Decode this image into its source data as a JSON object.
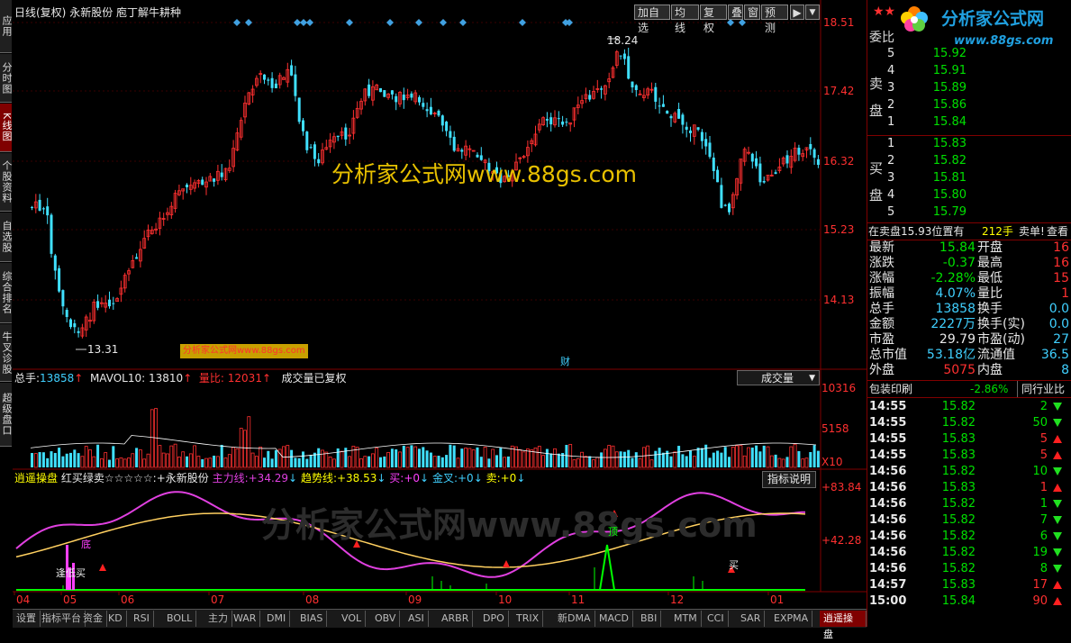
{
  "left_tabs": [
    {
      "label": "应用",
      "active": false
    },
    {
      "label": "分时图",
      "active": false
    },
    {
      "label": "K线图",
      "active": true
    },
    {
      "label": "个股资料",
      "active": false
    },
    {
      "label": "自选股",
      "active": false
    },
    {
      "label": "综合排名",
      "active": false
    },
    {
      "label": "牛叉诊股",
      "active": false
    },
    {
      "label": "超级盘口",
      "active": false
    }
  ],
  "chart_header": {
    "period": "日线(复权)",
    "stock": "永新股份",
    "indicator": "庖丁解牛耕种",
    "buttons": [
      "加自选",
      "均线",
      "复权",
      "叠",
      "窗",
      "预测"
    ]
  },
  "watermark_main": "分析家公式网www.88gs.com",
  "watermark_small": "分析家公式网www.88gs.com",
  "watermark_bottom": "分析家公式网www.88gs.com",
  "logo": {
    "text": "分析家公式网",
    "url": "www.88gs.com"
  },
  "price_axis": [
    "18.51",
    "17.42",
    "16.32",
    "15.23",
    "14.13"
  ],
  "price_marks": {
    "high": "18.24",
    "low": "13.31",
    "cai": "财"
  },
  "volume_header": {
    "total_label": "总手:",
    "total_value": "13858",
    "mavol_label": "MAVOL10:",
    "mavol_value": "13810",
    "ratio_label": "量比:",
    "ratio_value": "12031",
    "note": "成交量已复权",
    "dropdown": "成交量"
  },
  "volume_axis": [
    "10316",
    "5158",
    "X10"
  ],
  "indicator_header": {
    "name": "逍遥操盘",
    "desc": "红买绿卖☆☆☆☆☆:",
    "stock": "+永新股份",
    "main_label": "主力线:",
    "main_value": "+34.29",
    "trend_label": "趋势线:",
    "trend_value": "+38.53",
    "buy_label": "买:",
    "buy_value": "+0",
    "gold_label": "金叉:",
    "gold_value": "+0",
    "sell_label": "卖:",
    "sell_value": "+0",
    "button": "指标说明"
  },
  "indicator_axis": [
    "+83.84",
    "+42.28"
  ],
  "indicator_marks": {
    "bottom": "底",
    "bottom_buy": "逢低买",
    "top": "顶",
    "buy": "买"
  },
  "x_axis": [
    "04",
    "05",
    "06",
    "07",
    "08",
    "09",
    "10",
    "11",
    "12",
    "01"
  ],
  "bottom_tabs": [
    "设置",
    "指标平台",
    "资金",
    "KD",
    "RSI",
    "BOLL",
    "主力",
    "WAR",
    "DMI",
    "BIAS",
    "VOL",
    "OBV",
    "ASI",
    "ARBR",
    "DPO",
    "TRIX",
    "新DMA",
    "MACD",
    "BBI",
    "MTM",
    "CCI",
    "SAR",
    "EXPMA",
    "逍遥操盘"
  ],
  "right_panel": {
    "header": "委比",
    "sell_label": "卖盘",
    "buy_label": "买盘",
    "sell_rows": [
      {
        "level": "5",
        "price": "15.92"
      },
      {
        "level": "4",
        "price": "15.91"
      },
      {
        "level": "3",
        "price": "15.89"
      },
      {
        "level": "2",
        "price": "15.86"
      },
      {
        "level": "1",
        "price": "15.84"
      }
    ],
    "buy_rows": [
      {
        "level": "1",
        "price": "15.83"
      },
      {
        "level": "2",
        "price": "15.82"
      },
      {
        "level": "3",
        "price": "15.81"
      },
      {
        "level": "4",
        "price": "15.80"
      },
      {
        "level": "5",
        "price": "15.79"
      }
    ],
    "notice": {
      "prefix": "在卖盘",
      "price": "15.93",
      "mid": "位置有",
      "qty": "212手",
      "suffix": "卖单!",
      "link": "查看"
    },
    "stats": [
      {
        "l1": "最新",
        "v1": "15.84",
        "v1c": "g",
        "l2": "开盘",
        "v2": "16"
      },
      {
        "l1": "涨跌",
        "v1": "-0.37",
        "v1c": "g",
        "l2": "最高",
        "v2": "16"
      },
      {
        "l1": "涨幅",
        "v1": "-2.28%",
        "v1c": "g",
        "l2": "最低",
        "v2": "15"
      },
      {
        "l1": "振幅",
        "v1": "4.07%",
        "v1c": "c",
        "l2": "量比",
        "v2": "1"
      },
      {
        "l1": "总手",
        "v1": "13858",
        "v1c": "c",
        "l2": "换手",
        "v2": "0.0"
      },
      {
        "l1": "金额",
        "v1": "2227万",
        "v1c": "c",
        "l2": "换手(实)",
        "v2": "0.0"
      },
      {
        "l1": "市盈",
        "v1": "29.79",
        "v1c": "w",
        "l2": "市盈(动)",
        "v2": "27"
      },
      {
        "l1": "总市值",
        "v1": "53.18亿",
        "v1c": "c",
        "l2": "流通值",
        "v2": "36.5"
      },
      {
        "l1": "外盘",
        "v1": "5075",
        "v1c": "r",
        "l2": "内盘",
        "v2": "8"
      }
    ],
    "industry": {
      "name": "包装印刷",
      "change": "-2.86%",
      "compare": "同行业比"
    },
    "ticks": [
      {
        "time": "14:55",
        "price": "15.82",
        "vol": "2",
        "dir": "down"
      },
      {
        "time": "14:55",
        "price": "15.82",
        "vol": "50",
        "dir": "down"
      },
      {
        "time": "14:55",
        "price": "15.83",
        "vol": "5",
        "dir": "up"
      },
      {
        "time": "14:55",
        "price": "15.83",
        "vol": "5",
        "dir": "up"
      },
      {
        "time": "14:56",
        "price": "15.82",
        "vol": "10",
        "dir": "down"
      },
      {
        "time": "14:56",
        "price": "15.83",
        "vol": "1",
        "dir": "up"
      },
      {
        "time": "14:56",
        "price": "15.82",
        "vol": "1",
        "dir": "down"
      },
      {
        "time": "14:56",
        "price": "15.82",
        "vol": "7",
        "dir": "down"
      },
      {
        "time": "14:56",
        "price": "15.82",
        "vol": "6",
        "dir": "down"
      },
      {
        "time": "14:56",
        "price": "15.82",
        "vol": "19",
        "dir": "down"
      },
      {
        "time": "14:56",
        "price": "15.82",
        "vol": "8",
        "dir": "down"
      },
      {
        "time": "14:57",
        "price": "15.83",
        "vol": "17",
        "dir": "up"
      },
      {
        "time": "15:00",
        "price": "15.84",
        "vol": "90",
        "dir": "up"
      }
    ]
  }
}
